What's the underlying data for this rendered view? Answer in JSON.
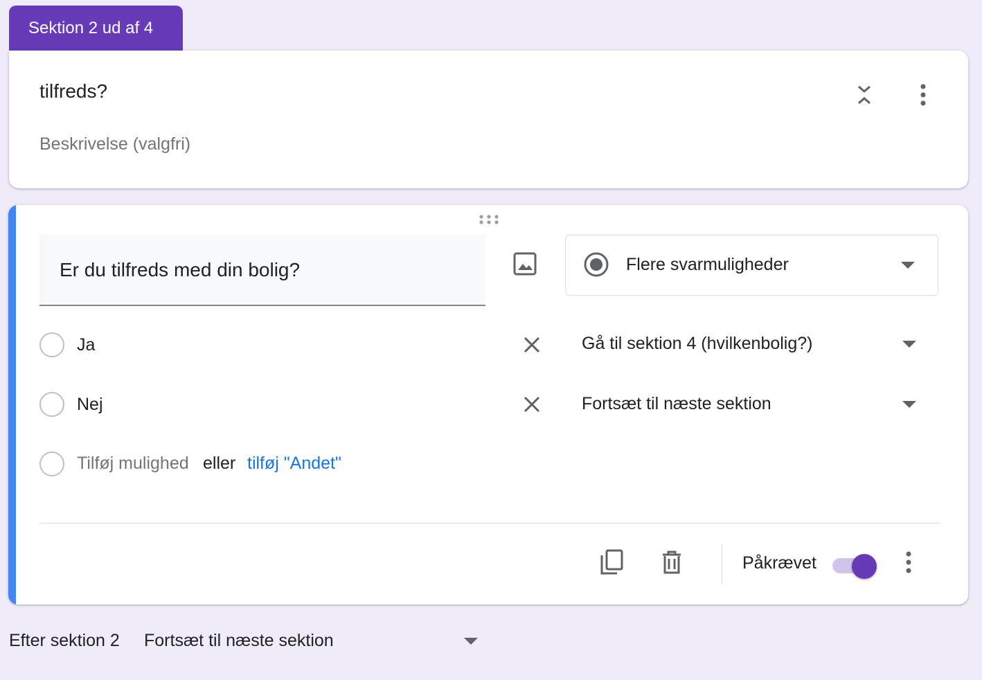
{
  "section": {
    "tab_label": "Sektion 2 ud af 4",
    "title": "tilfreds?",
    "description_placeholder": "Beskrivelse (valgfri)"
  },
  "question": {
    "title": "Er du tilfreds med din bolig?",
    "type": "Flere svarmuligheder",
    "options": [
      {
        "label": "Ja",
        "goto": "Gå til sektion 4 (hvilkenbolig?)"
      },
      {
        "label": "Nej",
        "goto": "Fortsæt til næste sektion"
      }
    ],
    "add_option": "Tilføj mulighed",
    "or": "eller",
    "add_other": "tilføj \"Andet\"",
    "required_label": "Påkrævet",
    "required": true
  },
  "after_section": {
    "label": "Efter sektion 2",
    "value": "Fortsæt til næste sektion"
  },
  "colors": {
    "accent": "#673ab7",
    "focus_bar": "#4285f4",
    "link": "#1a73e8",
    "background": "#f0ebf8"
  },
  "icons": [
    "collapse-icon",
    "more-vert-icon",
    "drag-handle-icon",
    "image-icon",
    "radio-checked-icon",
    "dropdown-arrow-icon",
    "close-icon",
    "copy-icon",
    "trash-icon"
  ]
}
